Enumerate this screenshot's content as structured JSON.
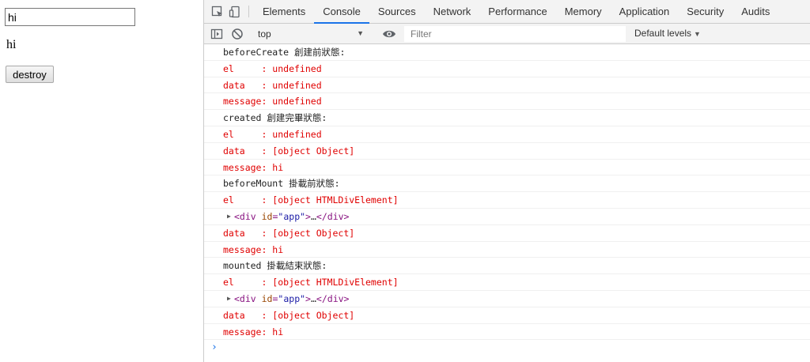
{
  "page": {
    "input_value": "hi",
    "text": "hi",
    "destroy_label": "destroy"
  },
  "devtools": {
    "tabs": [
      "Elements",
      "Console",
      "Sources",
      "Network",
      "Performance",
      "Memory",
      "Application",
      "Security",
      "Audits"
    ],
    "active_tab": "Console",
    "context": "top",
    "filter_placeholder": "Filter",
    "levels_label": "Default levels",
    "accent_color": "#1a73e8",
    "error_color": "#e00000"
  },
  "console": {
    "lines": [
      {
        "type": "log",
        "text": "beforeCreate 創建前狀態:"
      },
      {
        "type": "red",
        "text": "el     : undefined"
      },
      {
        "type": "red",
        "text": "data   : undefined"
      },
      {
        "type": "red",
        "text": "message: undefined"
      },
      {
        "type": "log",
        "text": "created 創建完畢狀態:"
      },
      {
        "type": "red",
        "text": "el     : undefined"
      },
      {
        "type": "red",
        "text": "data   : [object Object]"
      },
      {
        "type": "red",
        "text": "message: hi"
      },
      {
        "type": "log",
        "text": "beforeMount 掛載前狀態:"
      },
      {
        "type": "red",
        "text": "el     : [object HTMLDivElement]"
      },
      {
        "type": "node",
        "tag_open": "<div ",
        "attr": "id",
        "eq": "=",
        "val": "\"app\"",
        "close": ">",
        "ellipsis": "…",
        "tag_close": "</div>"
      },
      {
        "type": "red",
        "text": "data   : [object Object]"
      },
      {
        "type": "red",
        "text": "message: hi"
      },
      {
        "type": "log",
        "text": "mounted 掛載結束狀態:"
      },
      {
        "type": "red",
        "text": "el     : [object HTMLDivElement]"
      },
      {
        "type": "node",
        "tag_open": "<div ",
        "attr": "id",
        "eq": "=",
        "val": "\"app\"",
        "close": ">",
        "ellipsis": "…",
        "tag_close": "</div>"
      },
      {
        "type": "red",
        "text": "data   : [object Object]"
      },
      {
        "type": "red",
        "text": "message: hi"
      }
    ],
    "prompt": "›"
  }
}
